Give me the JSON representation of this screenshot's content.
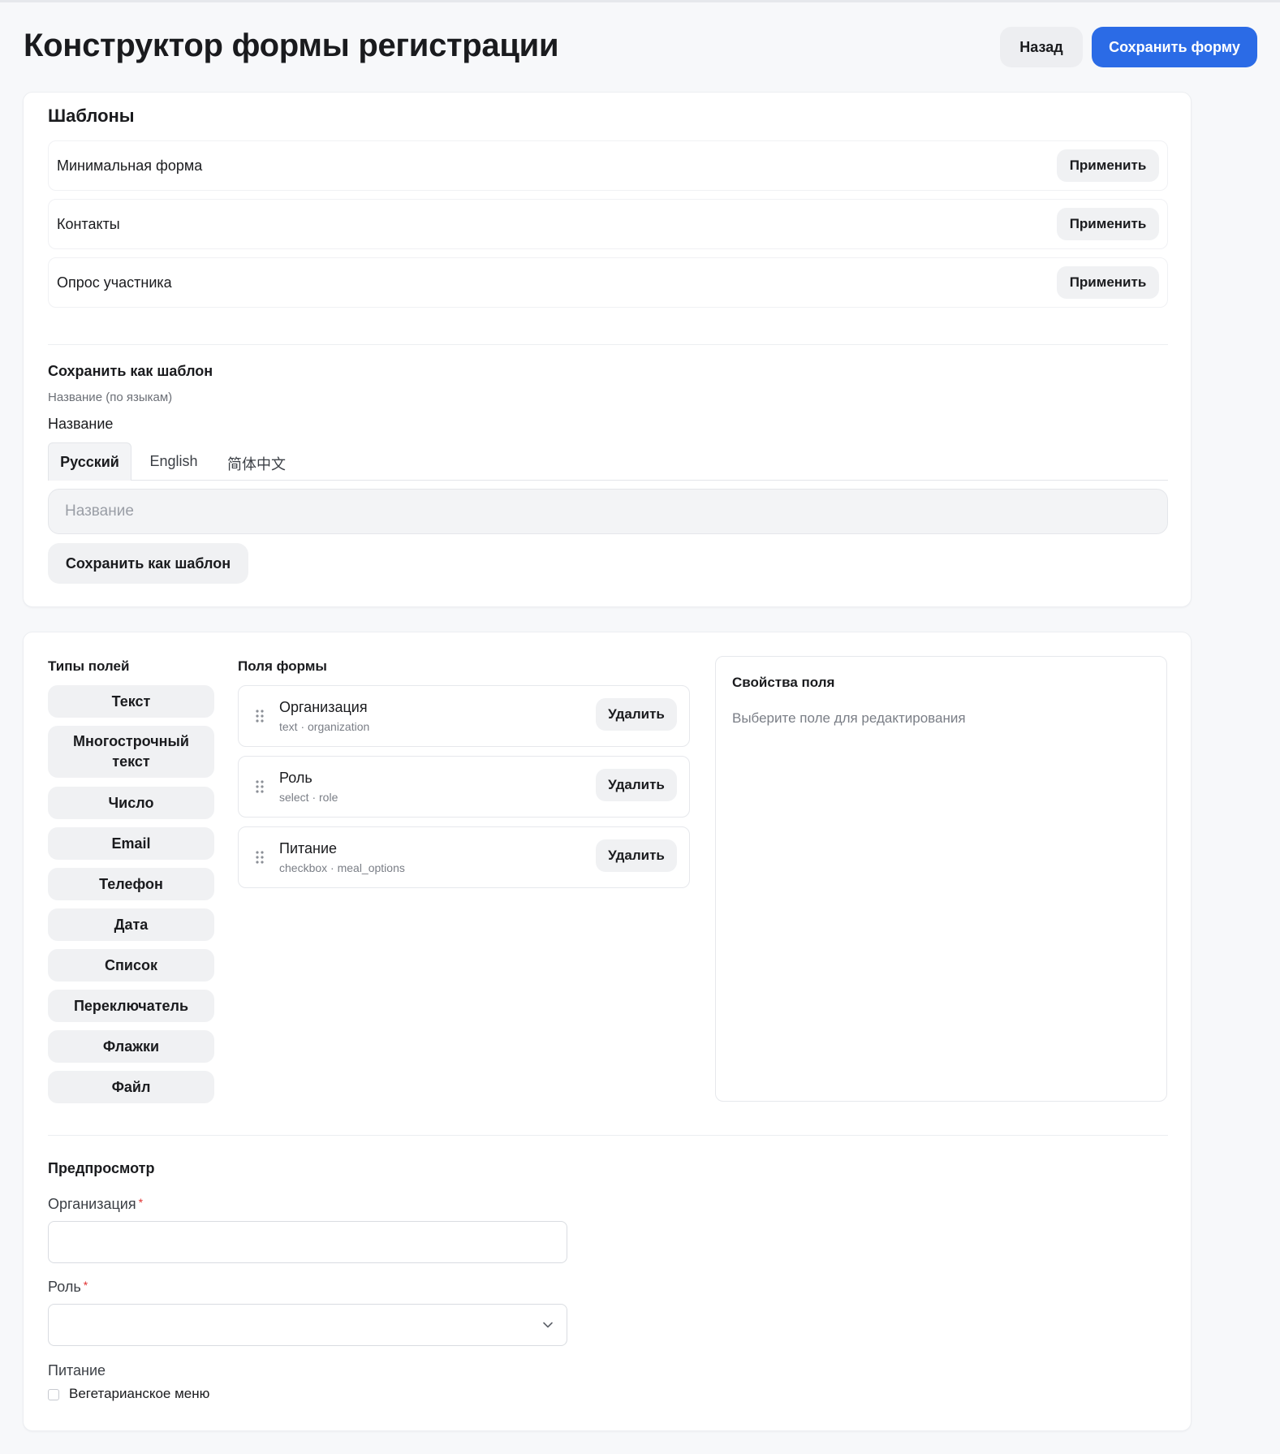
{
  "header": {
    "title": "Конструктор формы регистрации",
    "back_label": "Назад",
    "save_form_label": "Сохранить форму"
  },
  "templates": {
    "title": "Шаблоны",
    "items": [
      {
        "name": "Минимальная форма",
        "apply_label": "Применить"
      },
      {
        "name": "Контакты",
        "apply_label": "Применить"
      },
      {
        "name": "Опрос участника",
        "apply_label": "Применить"
      }
    ],
    "save_as": {
      "title": "Сохранить как шаблон",
      "caption": "Название (по языкам)",
      "name_label": "Название",
      "tabs": [
        "Русский",
        "English",
        "简体中文"
      ],
      "active_tab": "Русский",
      "input_placeholder": "Название",
      "input_value": "",
      "button_label": "Сохранить как шаблон"
    }
  },
  "builder": {
    "field_types_title": "Типы полей",
    "field_types": [
      "Текст",
      "Многострочный текст",
      "Число",
      "Email",
      "Телефон",
      "Дата",
      "Список",
      "Переключатель",
      "Флажки",
      "Файл"
    ],
    "form_fields_title": "Поля формы",
    "form_fields": [
      {
        "name": "Организация",
        "meta": "text · organization",
        "delete_label": "Удалить"
      },
      {
        "name": "Роль",
        "meta": "select · role",
        "delete_label": "Удалить"
      },
      {
        "name": "Питание",
        "meta": "checkbox · meal_options",
        "delete_label": "Удалить"
      }
    ],
    "properties": {
      "title": "Свойства поля",
      "hint": "Выберите поле для редактирования"
    }
  },
  "preview": {
    "title": "Предпросмотр",
    "organization_label": "Организация",
    "role_label": "Роль",
    "required_mark": "*",
    "meals_label": "Питание",
    "meal_option": "Вегетарианское меню",
    "meal_option_checked": false
  },
  "colors": {
    "accent": "#2b6be6",
    "required": "#e03131",
    "page_bg": "#f7f8fa"
  },
  "icons": {
    "drag": "drag-handle-icon",
    "select": "chevron-down-icon"
  }
}
